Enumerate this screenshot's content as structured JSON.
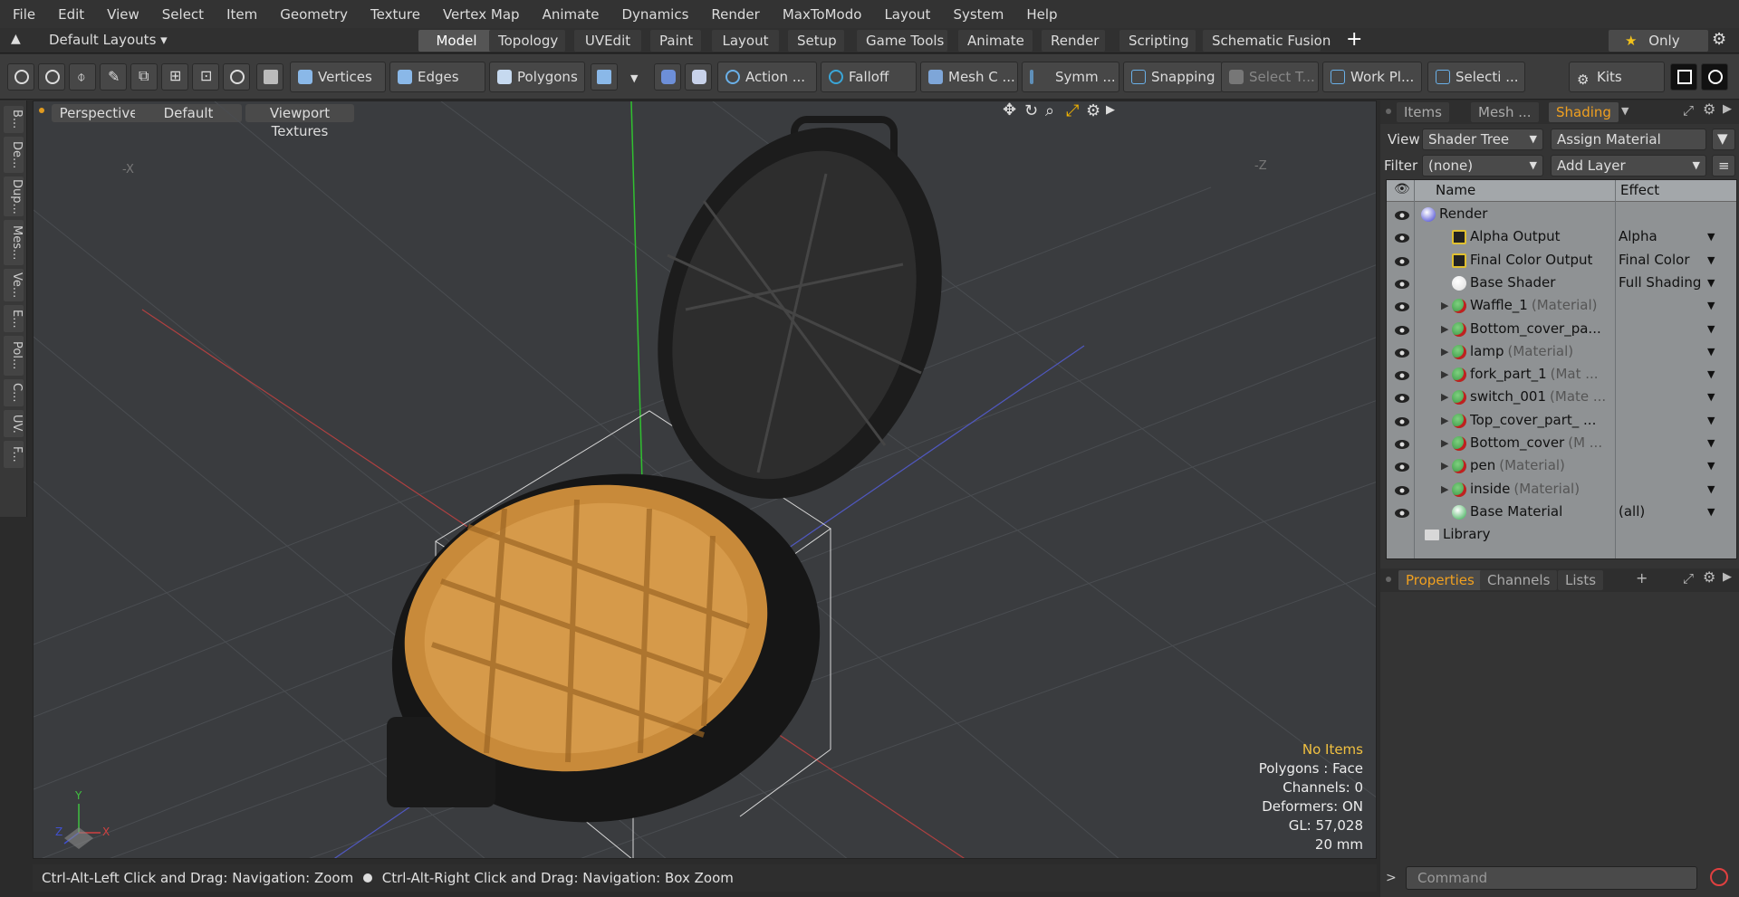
{
  "menu": [
    "File",
    "Edit",
    "View",
    "Select",
    "Item",
    "Geometry",
    "Texture",
    "Vertex Map",
    "Animate",
    "Dynamics",
    "Render",
    "MaxToModo",
    "Layout",
    "System",
    "Help"
  ],
  "layouts_dropdown": "Default Layouts",
  "layout_tabs": [
    "Model",
    "Topology",
    "UVEdit",
    "Paint",
    "Layout",
    "Setup",
    "Game Tools",
    "Animate",
    "Render",
    "Scripting",
    "Schematic Fusion"
  ],
  "only_label": "Only",
  "toolbar": {
    "vertices": "Vertices",
    "edges": "Edges",
    "polygons": "Polygons",
    "action": "Action",
    "falloff": "Falloff",
    "mesh": "Mesh C ...",
    "symmetry": "Symm ...",
    "snapping": "Snapping",
    "select_t": "Select T...",
    "workplane": "Work Pl...",
    "selection": "Selecti ...",
    "kits": "Kits"
  },
  "left_rail": [
    "B...",
    "De...",
    "Dup...",
    "Mes...",
    "Ve...",
    "E...",
    "Pol...",
    "C...",
    "UV.",
    "F..."
  ],
  "viewport": {
    "perspective": "Perspective",
    "default": "Default",
    "textures": "Viewport Textures",
    "axis_x": "X",
    "axis_y": "Y",
    "axis_z": "Z",
    "neg_x": "-X",
    "neg_z": "-Z",
    "info": {
      "no_items": "No Items",
      "polygons": "Polygons : Face",
      "channels": "Channels: 0",
      "deformers": "Deformers: ON",
      "gl": "GL: 57,028",
      "scale": "20 mm"
    }
  },
  "status_bar": {
    "left": "Ctrl-Alt-Left Click and Drag: Navigation: Zoom",
    "right": "Ctrl-Alt-Right Click and Drag: Navigation: Box Zoom"
  },
  "right_panel": {
    "tabs": [
      "Items",
      "Mesh ...",
      "Shading"
    ],
    "view_label": "View",
    "view_value": "Shader Tree",
    "assign_material": "Assign Material",
    "filter_label": "Filter",
    "filter_value": "(none)",
    "add_layer": "Add Layer",
    "col_name": "Name",
    "col_effect": "Effect",
    "rows": [
      {
        "name": "Render",
        "suffix": "",
        "effect": "",
        "ball": "#3a3ad0"
      },
      {
        "name": "Alpha Output",
        "suffix": "",
        "effect": "Alpha",
        "ball": "out"
      },
      {
        "name": "Final Color Output",
        "suffix": "",
        "effect": "Final Color",
        "ball": "out"
      },
      {
        "name": "Base Shader",
        "suffix": "",
        "effect": "Full Shading",
        "ball": "#dddddd"
      },
      {
        "name": "Waffle_1",
        "suffix": "(Material)",
        "effect": "",
        "ball": "mat"
      },
      {
        "name": "Bottom_cover_pa...",
        "suffix": "",
        "effect": "",
        "ball": "mat"
      },
      {
        "name": "lamp",
        "suffix": "(Material)",
        "effect": "",
        "ball": "mat"
      },
      {
        "name": "fork_part_1",
        "suffix": "(Mat ...",
        "effect": "",
        "ball": "mat"
      },
      {
        "name": "switch_001",
        "suffix": "(Mate ...",
        "effect": "",
        "ball": "mat"
      },
      {
        "name": "Top_cover_part_ ...",
        "suffix": "",
        "effect": "",
        "ball": "mat"
      },
      {
        "name": "Bottom_cover",
        "suffix": "(M ...",
        "effect": "",
        "ball": "mat"
      },
      {
        "name": "pen",
        "suffix": "(Material)",
        "effect": "",
        "ball": "mat"
      },
      {
        "name": "inside",
        "suffix": "(Material)",
        "effect": "",
        "ball": "mat"
      },
      {
        "name": "Base Material",
        "suffix": "",
        "effect": "(all)",
        "ball": "#2fa84a"
      },
      {
        "name": "Library",
        "suffix": "",
        "effect": "",
        "ball": "folder"
      }
    ],
    "prop_tabs": [
      "Properties",
      "Channels",
      "Lists"
    ],
    "command_placeholder": "Command"
  }
}
